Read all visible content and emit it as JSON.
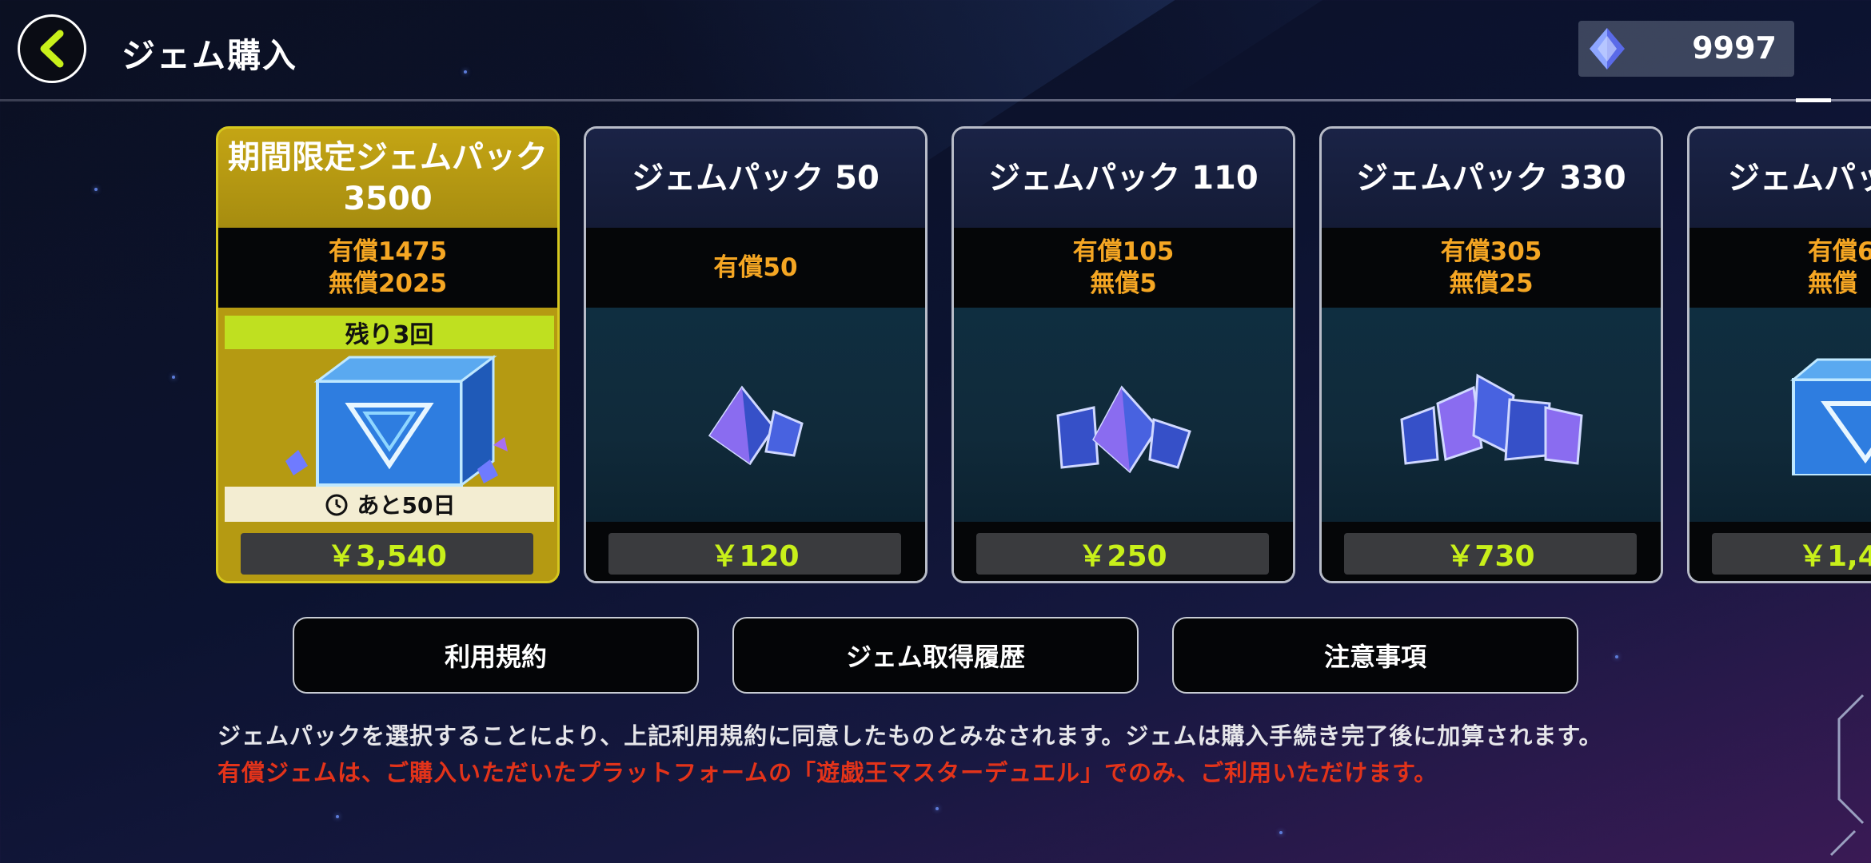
{
  "header": {
    "title": "ジェム購入",
    "gem_balance": "9997"
  },
  "packs": [
    {
      "name_line1": "期間限定ジェムパック",
      "name_line2": "3500",
      "paid": "有償1475",
      "free": "無償2025",
      "remaining": "残り3回",
      "period": "あと50日",
      "price": "￥3,540"
    },
    {
      "name_line1": "ジェムパック 50",
      "paid": "有償50",
      "price": "￥120"
    },
    {
      "name_line1": "ジェムパック 110",
      "paid": "有償105",
      "free": "無償5",
      "price": "￥250"
    },
    {
      "name_line1": "ジェムパック 330",
      "paid": "有償305",
      "free": "無償25",
      "price": "￥730"
    },
    {
      "name_line1": "ジェムパッ",
      "paid": "有償6",
      "free": "無償",
      "price": "￥1,4"
    }
  ],
  "buttons": {
    "terms": "利用規約",
    "history": "ジェム取得履歴",
    "notes": "注意事項"
  },
  "notice": {
    "line1": "ジェムパックを選択することにより、上記利用規約に同意したものとみなされます。ジェムは購入手続き完了後に加算されます。",
    "line2": "有償ジェムは、ご購入いただいたプラットフォームの「遊戯王マスターデュエル」でのみ、ご利用いただけます。"
  },
  "colors": {
    "accent": "#c8f01a",
    "gold": "#b59a12",
    "amount": "#f5a623",
    "warning": "#e2331a"
  }
}
